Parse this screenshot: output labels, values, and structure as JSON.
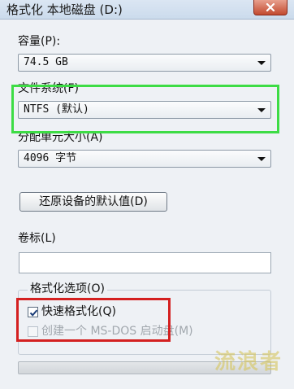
{
  "window": {
    "title": "格式化 本地磁盘 (D:)"
  },
  "capacity": {
    "label": "容量(P):",
    "value": "74.5 GB"
  },
  "filesystem": {
    "label": "文件系统(F)",
    "value": "NTFS (默认)"
  },
  "allocation": {
    "label": "分配单元大小(A)",
    "value": "4096 字节"
  },
  "restore_button": {
    "label": "还原设备的默认值(D)"
  },
  "volume_label": {
    "label": "卷标(L)",
    "value": ""
  },
  "format_options": {
    "legend": "格式化选项(O)",
    "quick_format": {
      "label": "快速格式化(Q)",
      "checked": true
    },
    "msdos_startup": {
      "label": "创建一个 MS-DOS 启动盘(M)",
      "checked": false,
      "disabled": true
    }
  },
  "progress": {
    "value": 0
  },
  "watermark": {
    "text": "流浪者"
  },
  "colors": {
    "highlight_green": "#3ddc45",
    "highlight_red": "#d42020",
    "close_button": "#c24a2f"
  },
  "icons": {
    "close": "close-icon",
    "dropdown": "chevron-down-icon",
    "check": "checkmark-icon"
  }
}
